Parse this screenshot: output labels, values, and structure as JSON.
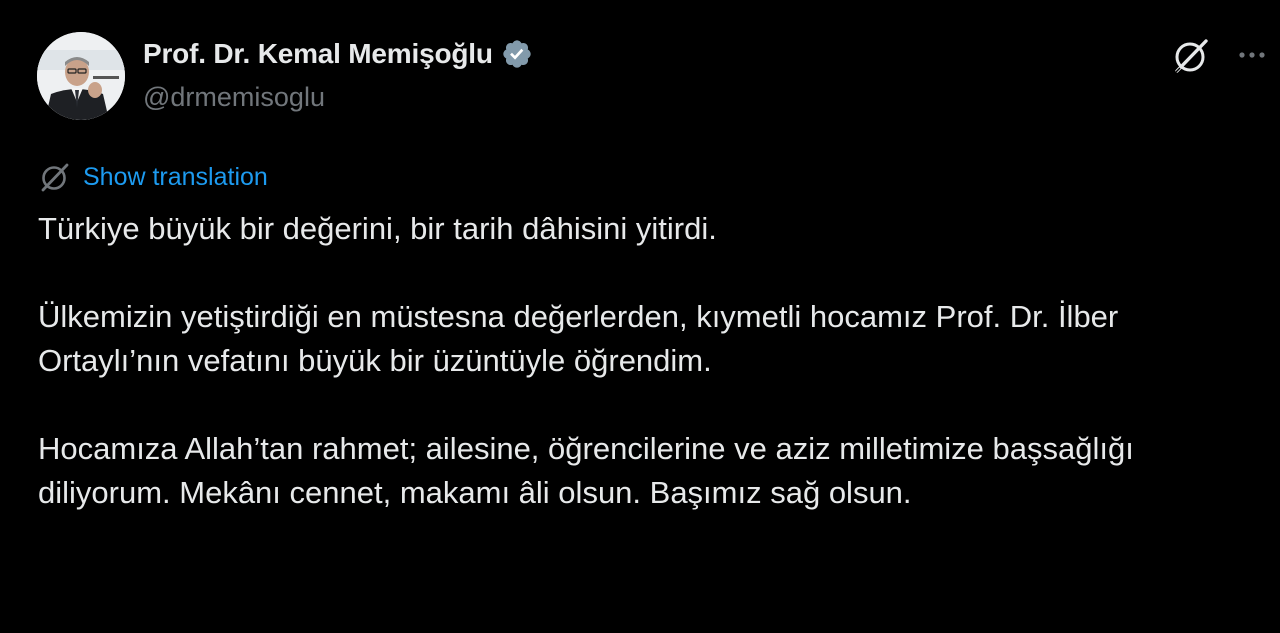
{
  "author": {
    "display_name": "Prof. Dr. Kemal Memişoğlu",
    "handle": "@drmemisoglu",
    "verified_icon": "verified-badge-icon",
    "avatar": "avatar-photo"
  },
  "actions": {
    "grok_icon": "grok-icon",
    "more_icon": "more-options-icon"
  },
  "translation": {
    "link_text": "Show translation",
    "icon": "translate-icon"
  },
  "body": {
    "paragraph_1": "Türkiye büyük bir değerini, bir tarih dâhisini yitirdi.",
    "paragraph_2": "Ülkemizin yetiştirdiği en müstesna değerlerden, kıymetli hocamız Prof. Dr. İlber Ortaylı’nın vefatını büyük bir üzüntüyle öğrendim.",
    "paragraph_3": "Hocamıza Allah’tan rahmet; ailesine, öğrencilerine ve aziz milletimize başsağlığı diliyorum. Mekânı cennet, makamı âli olsun. Başımız sağ olsun."
  },
  "colors": {
    "background": "#000000",
    "text_primary": "#e7e9ea",
    "text_secondary": "#71767b",
    "link": "#1d9bf0",
    "verified": "#829aab"
  }
}
